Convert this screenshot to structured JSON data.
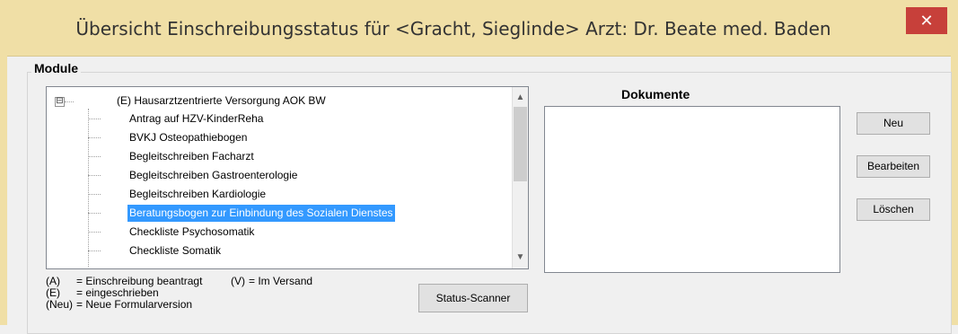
{
  "window": {
    "title": "Übersicht Einschreibungsstatus für <Gracht, Sieglinde> Arzt: Dr. Beate med. Baden",
    "close_symbol": "✕"
  },
  "module_group": {
    "label": "Module",
    "tree": {
      "root": {
        "expander_symbol": "⊟",
        "label": "(E) Hausarztzentrierte Versorgung AOK BW"
      },
      "items": [
        "Antrag auf HZV-KinderReha",
        "BVKJ Osteopathiebogen",
        "Begleitschreiben Facharzt",
        "Begleitschreiben Gastroenterologie",
        "Begleitschreiben Kardiologie",
        "Beratungsbogen zur Einbindung des Sozialen Dienstes",
        "Checkliste Psychosomatik",
        "Checkliste Somatik"
      ],
      "selected_index": 5
    },
    "legend": [
      {
        "code": "(A)",
        "text": "= Einschreibung beantragt"
      },
      {
        "code": "(E)",
        "text": "= eingeschrieben"
      },
      {
        "code": "(Neu)",
        "text": "= Neue Formularversion"
      }
    ],
    "legend_extra": {
      "code": "(V)",
      "text": "= Im Versand"
    },
    "status_scanner_label": "Status-Scanner"
  },
  "documents": {
    "label": "Dokumente",
    "buttons": {
      "new": "Neu",
      "edit": "Bearbeiten",
      "delete": "Löschen"
    }
  },
  "scroll": {
    "up": "▲",
    "down": "▼"
  }
}
